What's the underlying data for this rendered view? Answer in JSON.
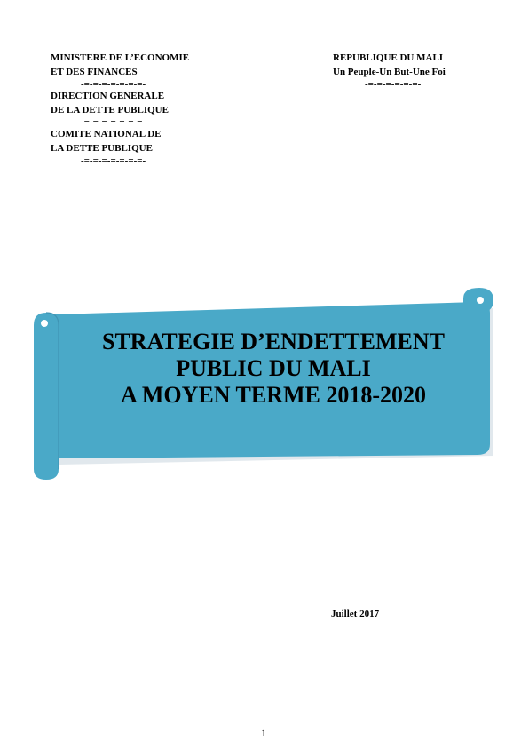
{
  "header_left": {
    "line1": "MINISTERE DE L’ECONOMIE",
    "line2": "ET DES FINANCES",
    "sep1": "-=-=-=-=-=-=-=-",
    "line3": "DIRECTION GENERALE",
    "line4": "DE LA DETTE PUBLIQUE",
    "sep2": "-=-=-=-=-=-=-=-",
    "line5": "COMITE NATIONAL DE",
    "line6": "LA DETTE PUBLIQUE",
    "sep3": "-=-=-=-=-=-=-=-"
  },
  "header_right": {
    "line1": "REPUBLIQUE DU MALI",
    "line2": "Un Peuple-Un But-Une Foi",
    "sep": "-=-=-=-=-=-=-"
  },
  "title": {
    "line1": "STRATEGIE D’ENDETTEMENT",
    "line2": "PUBLIC DU MALI",
    "line3": "A MOYEN TERME 2018-2020"
  },
  "banner_colors": {
    "fill": "#4aa9c8",
    "shadow": "#c9d6de",
    "edge": "#3f94b3"
  },
  "date": "Juillet 2017",
  "page_number": "1"
}
